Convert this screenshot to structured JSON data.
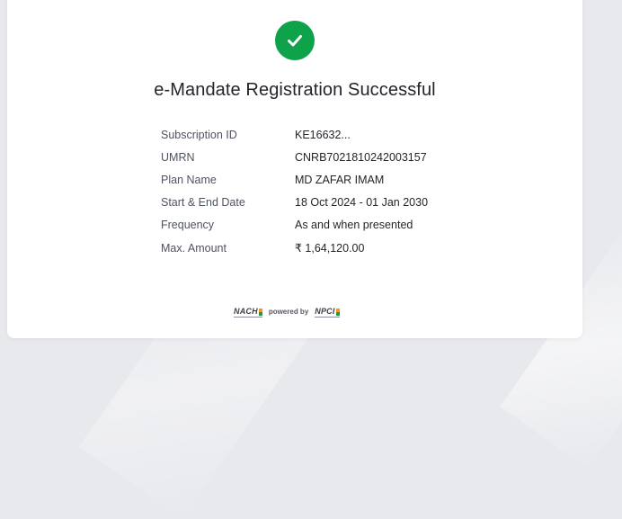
{
  "status": {
    "title": "e-Mandate Registration Successful",
    "icon": "check-icon",
    "icon_color": "#0ea24a"
  },
  "details": [
    {
      "label": "Subscription ID",
      "value": "KE16632..."
    },
    {
      "label": "UMRN",
      "value": "CNRB7021810242003157"
    },
    {
      "label": "Plan Name",
      "value": "MD ZAFAR IMAM"
    },
    {
      "label": "Start & End Date",
      "value": "18 Oct 2024 - 01 Jan 2030"
    },
    {
      "label": "Frequency",
      "value": "As and when presented"
    },
    {
      "label": "Max. Amount",
      "value": "₹ 1,64,120.00"
    }
  ],
  "footer": {
    "nach_logo": "NACH",
    "powered_by": "powered by",
    "npci_logo": "NPCI"
  }
}
